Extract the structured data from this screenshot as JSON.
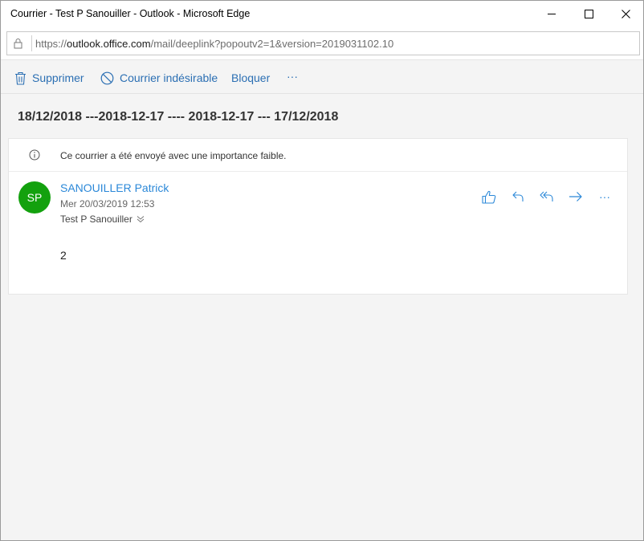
{
  "window": {
    "title": "Courrier - Test P Sanouiller - Outlook - Microsoft Edge"
  },
  "address": {
    "url_prefix": "https://",
    "url_host": "outlook.office.com",
    "url_rest": "/mail/deeplink?popoutv2=1&version=2019031102.10"
  },
  "toolbar": {
    "delete_label": "Supprimer",
    "junk_label": "Courrier indésirable",
    "block_label": "Bloquer",
    "more_label": "···"
  },
  "message": {
    "subject": "18/12/2018 ---2018-12-17 ---- 2018-12-17 --- 17/12/2018",
    "importance_notice": "Ce courrier a été envoyé avec une importance faible.",
    "avatar_initials": "SP",
    "sender": "SANOUILLER Patrick",
    "date": "Mer 20/03/2019 12:53",
    "recipient": "Test P Sanouiller",
    "body": "2",
    "more_actions_label": "···"
  },
  "colors": {
    "accent": "#2b88d8",
    "avatar_bg": "#13a10e"
  }
}
